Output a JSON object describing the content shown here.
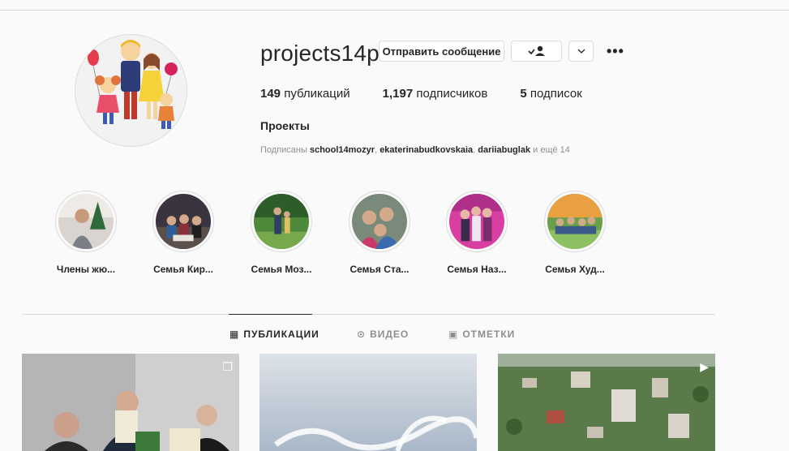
{
  "profile": {
    "username": "projects14p",
    "message_button": "Отправить сообщение",
    "more": "•••",
    "full_name": "Проекты",
    "stats": {
      "posts_count": "149",
      "posts_label": "публикаций",
      "followers_count": "1,197",
      "followers_label": "подписчиков",
      "following_count": "5",
      "following_label": "подписок"
    },
    "followed_by": {
      "prefix": "Подписаны",
      "user1": "school14mozyr",
      "user2": "ekaterinabudkovskaia",
      "user3": "dariiabuglak",
      "suffix": "и ещё 14"
    }
  },
  "highlights": [
    {
      "label": "Члены жю..."
    },
    {
      "label": "Семья Кир..."
    },
    {
      "label": "Семья Моз..."
    },
    {
      "label": "Семья Ста..."
    },
    {
      "label": "Семья Наз..."
    },
    {
      "label": "Семья Худ..."
    }
  ],
  "tabs": {
    "publications": "ПУБЛИКАЦИИ",
    "video": "ВИДЕО",
    "tagged": "ОТМЕТКИ"
  },
  "colors": {
    "text": "#262626",
    "secondary": "#8e8e8e",
    "border": "#dbdbdb",
    "background": "#fafafa"
  }
}
